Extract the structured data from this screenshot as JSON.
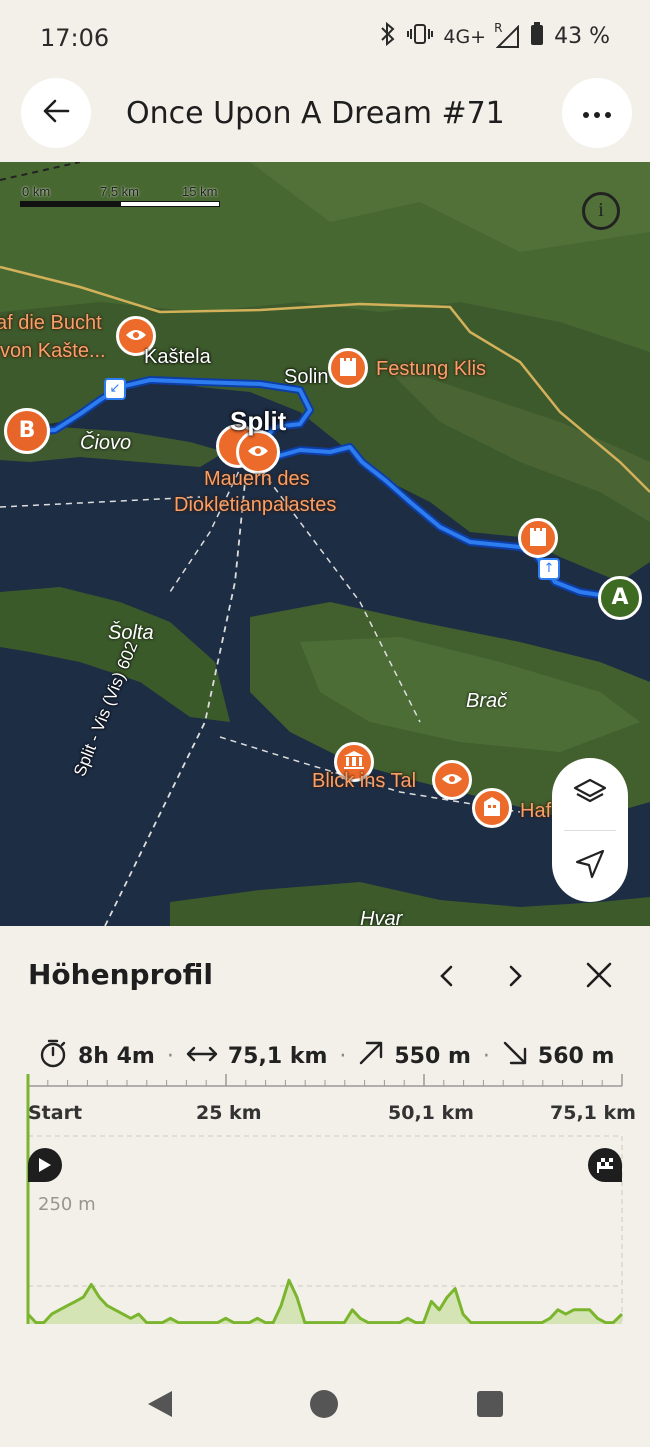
{
  "status_bar": {
    "time": "17:06",
    "network": "4G+",
    "roaming": "R",
    "battery": "43 %"
  },
  "header": {
    "title": "Once Upon A Dream #71",
    "back_icon": "arrow-left-icon",
    "menu_icon": "more-horizontal-icon"
  },
  "map": {
    "scale": {
      "labels": [
        "0 km",
        "7,5 km",
        "15 km"
      ]
    },
    "labels": {
      "bucht_1": "af die Bucht",
      "bucht_2": "von Kašte...",
      "kastela": "Kaštela",
      "solin": "Solin",
      "festung": "Festung Klis",
      "split": "Split",
      "ciovo": "Čiovo",
      "mauern_1": "Mauern des",
      "mauern_2": "Diokletianpalastes",
      "solta": "Šolta",
      "brac": "Brač",
      "blick": "Blick ins Tal",
      "hafen": "Hafen Bo",
      "ferry": "Split - Vis (Vis) 602",
      "hvar": "Hvar"
    },
    "markers": {
      "start": "A",
      "end": "B"
    },
    "tools": {
      "layers_icon": "layers-icon",
      "locate_icon": "navigation-arrow-icon",
      "info_icon": "info-icon"
    }
  },
  "elevation_panel": {
    "title": "Höhenprofil",
    "stats": {
      "duration": "8h 4m",
      "distance": "75,1 km",
      "ascent": "550 m",
      "descent": "560 m"
    },
    "axis_ticks": [
      "Start",
      "25 km",
      "50,1 km",
      "75,1 km"
    ],
    "y_label": "250 m"
  },
  "chart_data": {
    "type": "area",
    "xlabel": "",
    "ylabel": "",
    "xlim": [
      0,
      75.1
    ],
    "ylim": [
      0,
      300
    ],
    "y_ticks": [
      250
    ],
    "x": [
      0,
      1,
      2,
      3,
      4,
      5,
      6,
      7,
      8,
      9,
      10,
      11,
      12,
      13,
      14,
      15,
      16,
      17,
      18,
      19,
      20,
      21,
      22,
      23,
      24,
      25,
      26,
      27,
      28,
      29,
      30,
      31,
      32,
      33,
      34,
      35,
      36,
      37,
      38,
      39,
      40,
      41,
      42,
      43,
      44,
      45,
      46,
      47,
      48,
      49,
      50,
      51,
      52,
      53,
      54,
      55,
      56,
      57,
      58,
      59,
      60,
      61,
      62,
      63,
      64,
      65,
      66,
      67,
      68,
      69,
      70,
      71,
      72,
      73,
      74,
      75.1
    ],
    "values": [
      40,
      30,
      30,
      40,
      45,
      50,
      55,
      60,
      75,
      60,
      50,
      45,
      40,
      35,
      40,
      30,
      30,
      30,
      35,
      30,
      30,
      30,
      30,
      30,
      30,
      35,
      30,
      30,
      30,
      35,
      30,
      30,
      50,
      80,
      60,
      30,
      30,
      30,
      30,
      30,
      30,
      45,
      35,
      30,
      30,
      30,
      30,
      30,
      35,
      30,
      30,
      55,
      45,
      60,
      70,
      40,
      30,
      30,
      30,
      30,
      30,
      30,
      30,
      30,
      30,
      30,
      35,
      45,
      40,
      45,
      45,
      45,
      35,
      30,
      30,
      40
    ]
  },
  "nav_bar": {
    "back_icon": "triangle-back-icon",
    "home_icon": "circle-home-icon",
    "recents_icon": "square-recents-icon"
  }
}
